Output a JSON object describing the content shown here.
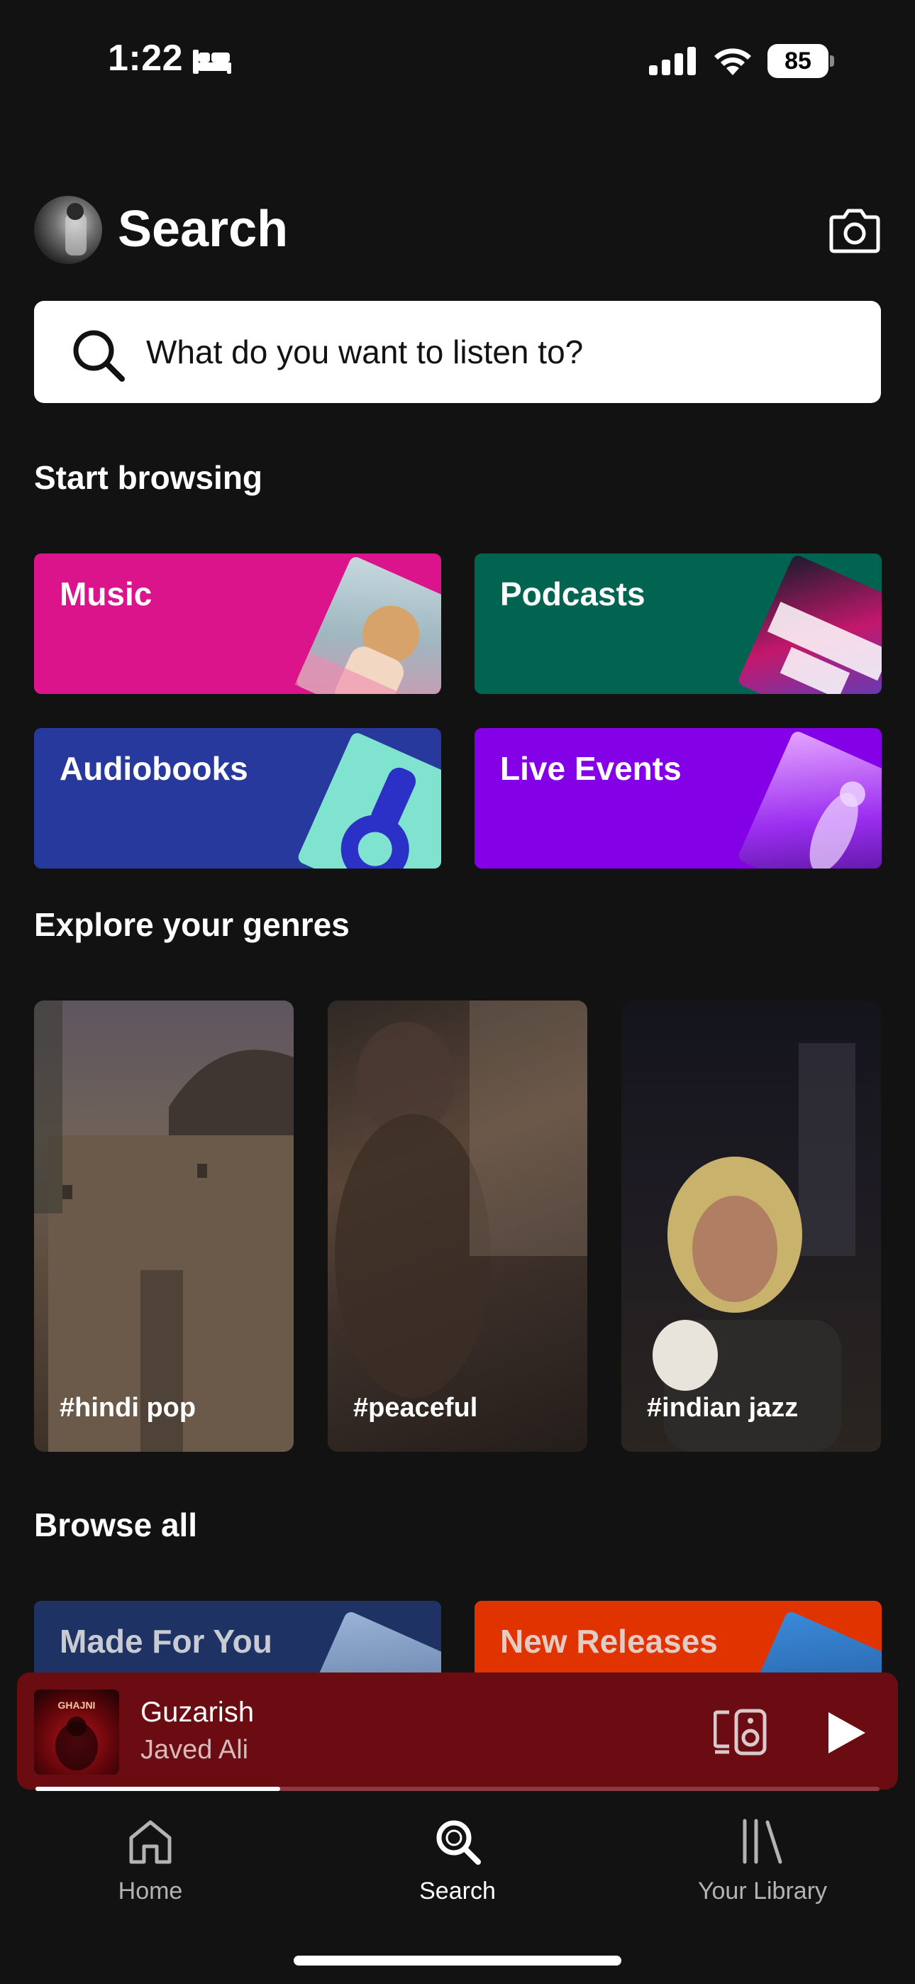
{
  "status_bar": {
    "time": "1:22",
    "battery": "85",
    "icons": [
      "bed-icon",
      "signal-icon",
      "wifi-icon",
      "battery-icon"
    ]
  },
  "header": {
    "title": "Search",
    "avatar": "avatar",
    "camera_icon": "camera-icon"
  },
  "search": {
    "placeholder": "What do you want to listen to?",
    "icon": "search-icon"
  },
  "start_browsing": {
    "title": "Start browsing",
    "tiles": [
      {
        "label": "Music",
        "color": "#dc148c"
      },
      {
        "label": "Podcasts",
        "color": "#006450"
      },
      {
        "label": "Audiobooks",
        "color": "#1e3264"
      },
      {
        "label": "Live Events",
        "color": "#8400e7"
      }
    ]
  },
  "genres": {
    "title": "Explore your genres",
    "cards": [
      {
        "label": "#hindi pop"
      },
      {
        "label": "#peaceful"
      },
      {
        "label": "#indian jazz"
      }
    ]
  },
  "browse_all": {
    "title": "Browse all",
    "tiles": [
      {
        "label": "Made For You",
        "color": "#1e3264"
      },
      {
        "label": "New Releases",
        "color": "#e8115b"
      }
    ]
  },
  "mini_player": {
    "title": "Guzarish",
    "artist": "Javed Ali",
    "album_art_text": "GHAJNI",
    "progress": 0.29,
    "background": "#6b0c12",
    "icons": [
      "devices-icon",
      "play-icon"
    ]
  },
  "bottom_nav": {
    "items": [
      {
        "label": "Home",
        "icon": "home-icon",
        "active": false
      },
      {
        "label": "Search",
        "icon": "search-icon",
        "active": true
      },
      {
        "label": "Your Library",
        "icon": "library-icon",
        "active": false
      }
    ]
  }
}
